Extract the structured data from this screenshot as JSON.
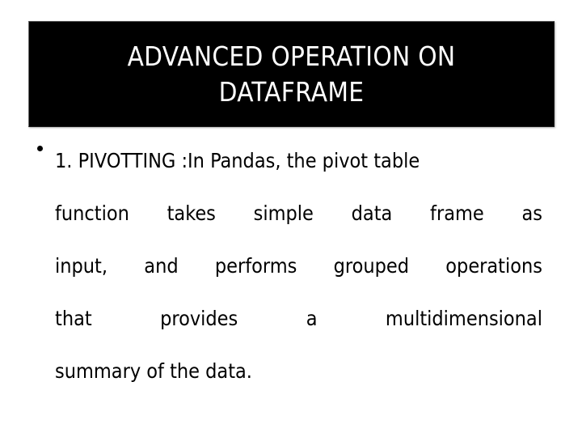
{
  "slide": {
    "background_color": "#ffffff",
    "title": {
      "background_color": "#000000",
      "text_color": "#ffffff",
      "lines": [
        "ADVANCED OPERATION ON",
        "DATAFRAME"
      ]
    },
    "body": {
      "text_color": "#000000",
      "bullet_glyph": "•",
      "full_text": "1. PIVOTTING :In Pandas, the pivot table function takes simple data frame as input, and performs grouped operations that provides a multidimensional summary of the data.",
      "lines": [
        {
          "id": "line-1",
          "justified": false,
          "text": "1. PIVOTTING :In Pandas, the pivot table",
          "words": [
            "1.",
            "PIVOTTING",
            ":In",
            "Pandas,",
            "the",
            "pivot",
            "table"
          ]
        },
        {
          "id": "line-2",
          "justified": true,
          "text": "function takes simple data frame as",
          "words": [
            "function",
            "takes",
            "simple",
            "data",
            "frame",
            "as"
          ]
        },
        {
          "id": "line-3",
          "justified": true,
          "text": "input, and performs grouped operations",
          "words": [
            "input,",
            "and",
            "performs",
            "grouped",
            "operations"
          ]
        },
        {
          "id": "line-4",
          "justified": true,
          "text": "that provides a multidimensional",
          "words": [
            "that",
            "provides",
            "a",
            "multidimensional"
          ]
        },
        {
          "id": "line-5",
          "justified": false,
          "text": "summary of the data.",
          "words": [
            "summary",
            "of",
            "the",
            "data."
          ]
        }
      ]
    }
  }
}
